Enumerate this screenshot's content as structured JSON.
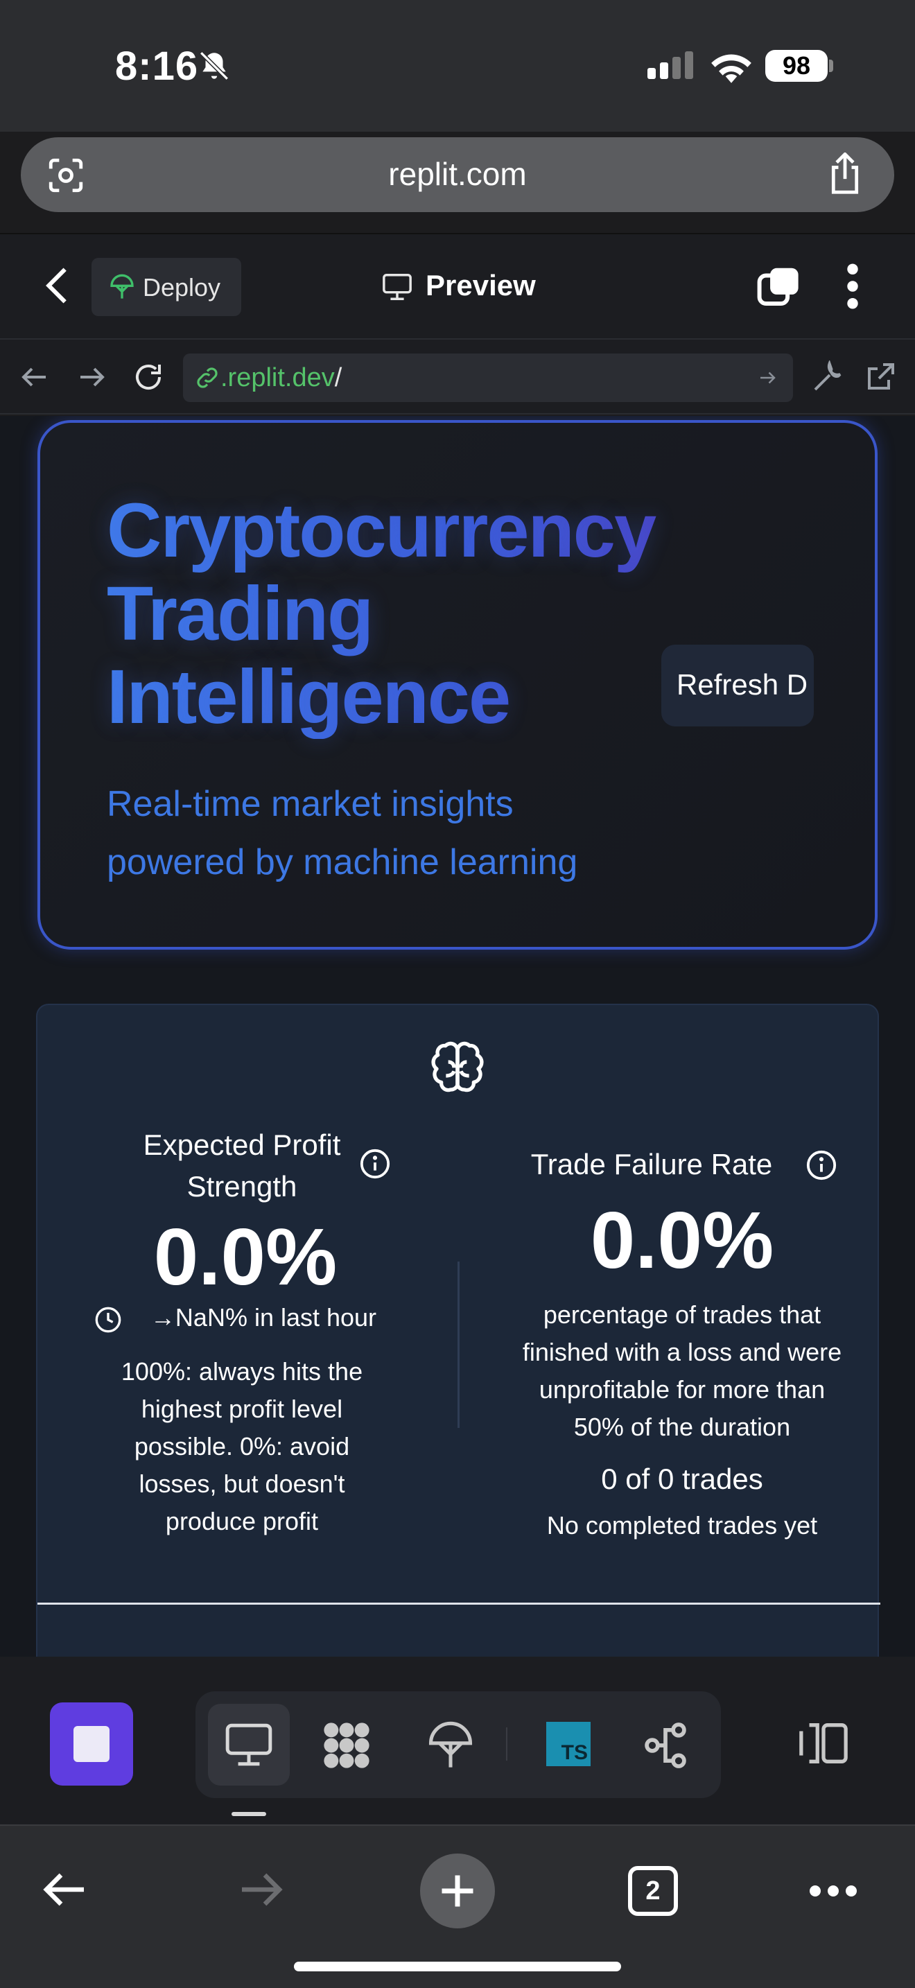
{
  "status_bar": {
    "time": "8:16",
    "battery": "98"
  },
  "browser": {
    "url": "replit.com",
    "open_tabs": "2"
  },
  "replit": {
    "deploy_label": "Deploy",
    "preview_label": "Preview",
    "address_domain": ".replit.dev",
    "address_path": "/"
  },
  "hero": {
    "title_line1": "Cryptocurrency",
    "title_line2": "Trading",
    "title_line3": "Intelligence",
    "subtitle_line1": "Real-time market insights",
    "subtitle_line2": "powered by machine learning",
    "refresh_label": "Refresh D"
  },
  "metrics": {
    "expected_profit": {
      "title_line1": "Expected Profit",
      "title_line2": "Strength",
      "value": "0.0%",
      "trend": "→NaN% in last hour",
      "description": "100%: always hits the highest profit level possible. 0%: avoid losses, but doesn't produce profit"
    },
    "trade_failure": {
      "title": "Trade Failure Rate",
      "value": "0.0%",
      "description": "percentage of trades that finished with a loss and were unprofitable for more than 50% of the duration",
      "count": "0 of 0 trades",
      "empty_note": "No completed trades yet"
    }
  },
  "colors": {
    "accent": "#3d78e4",
    "hero_border": "#3a56c9",
    "card_bg": "#1c2738",
    "stop_button": "#5f3de0",
    "typescript": "#1a8fb0",
    "link_green": "#55c26a"
  },
  "icons": [
    "bell-slash-icon",
    "wifi-icon",
    "lens-icon",
    "share-icon",
    "back-chevron-icon",
    "deploy-icon",
    "monitor-icon",
    "tabs-icon",
    "more-vertical-icon",
    "arrow-left-icon",
    "arrow-right-icon",
    "reload-icon",
    "link-icon",
    "wrench-icon",
    "external-link-icon",
    "brain-icon",
    "info-icon",
    "clock-icon",
    "stop-icon",
    "packages-icon",
    "deploy-tool-icon",
    "typescript-icon",
    "git-icon",
    "layout-icon",
    "plus-icon",
    "more-horizontal-icon"
  ]
}
